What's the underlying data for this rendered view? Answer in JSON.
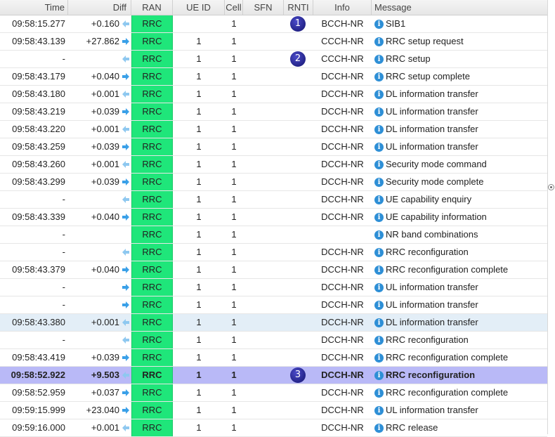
{
  "columns": {
    "time": "Time",
    "diff": "Diff",
    "ran": "RAN",
    "ue_id": "UE ID",
    "cell": "Cell",
    "sfn": "SFN",
    "rnti": "RNTI",
    "info": "Info",
    "message": "Message"
  },
  "colors": {
    "ran_cell_bg": "#1fe67a",
    "arrow_ul": "#3aa0e8",
    "arrow_dl": "#8ec8f0",
    "selected_row_bg": "#b9b9f7",
    "highlight_row_bg": "#e3eef7",
    "badge_bg": "#1e1e8a"
  },
  "rows": [
    {
      "time": "09:58:15.277",
      "diff": "+0.160",
      "dir": "dl",
      "ran": "RRC",
      "ue_id": "",
      "cell": "1",
      "sfn": "",
      "rnti": "",
      "badge": "1",
      "info": "BCCH-NR",
      "message": "SIB1"
    },
    {
      "time": "09:58:43.139",
      "diff": "+27.862",
      "dir": "ul",
      "ran": "RRC",
      "ue_id": "1",
      "cell": "1",
      "sfn": "",
      "rnti": "",
      "badge": "",
      "info": "CCCH-NR",
      "message": "RRC setup request"
    },
    {
      "time": "-",
      "diff": "",
      "dir": "dl",
      "ran": "RRC",
      "ue_id": "1",
      "cell": "1",
      "sfn": "",
      "rnti": "",
      "badge": "2",
      "info": "CCCH-NR",
      "message": "RRC setup"
    },
    {
      "time": "09:58:43.179",
      "diff": "+0.040",
      "dir": "ul",
      "ran": "RRC",
      "ue_id": "1",
      "cell": "1",
      "sfn": "",
      "rnti": "",
      "badge": "",
      "info": "DCCH-NR",
      "message": "RRC setup complete"
    },
    {
      "time": "09:58:43.180",
      "diff": "+0.001",
      "dir": "dl",
      "ran": "RRC",
      "ue_id": "1",
      "cell": "1",
      "sfn": "",
      "rnti": "",
      "badge": "",
      "info": "DCCH-NR",
      "message": "DL information transfer"
    },
    {
      "time": "09:58:43.219",
      "diff": "+0.039",
      "dir": "ul",
      "ran": "RRC",
      "ue_id": "1",
      "cell": "1",
      "sfn": "",
      "rnti": "",
      "badge": "",
      "info": "DCCH-NR",
      "message": "UL information transfer"
    },
    {
      "time": "09:58:43.220",
      "diff": "+0.001",
      "dir": "dl",
      "ran": "RRC",
      "ue_id": "1",
      "cell": "1",
      "sfn": "",
      "rnti": "",
      "badge": "",
      "info": "DCCH-NR",
      "message": "DL information transfer"
    },
    {
      "time": "09:58:43.259",
      "diff": "+0.039",
      "dir": "ul",
      "ran": "RRC",
      "ue_id": "1",
      "cell": "1",
      "sfn": "",
      "rnti": "",
      "badge": "",
      "info": "DCCH-NR",
      "message": "UL information transfer"
    },
    {
      "time": "09:58:43.260",
      "diff": "+0.001",
      "dir": "dl",
      "ran": "RRC",
      "ue_id": "1",
      "cell": "1",
      "sfn": "",
      "rnti": "",
      "badge": "",
      "info": "DCCH-NR",
      "message": "Security mode command"
    },
    {
      "time": "09:58:43.299",
      "diff": "+0.039",
      "dir": "ul",
      "ran": "RRC",
      "ue_id": "1",
      "cell": "1",
      "sfn": "",
      "rnti": "",
      "badge": "",
      "info": "DCCH-NR",
      "message": "Security mode complete"
    },
    {
      "time": "-",
      "diff": "",
      "dir": "dl",
      "ran": "RRC",
      "ue_id": "1",
      "cell": "1",
      "sfn": "",
      "rnti": "",
      "badge": "",
      "info": "DCCH-NR",
      "message": "UE capability enquiry"
    },
    {
      "time": "09:58:43.339",
      "diff": "+0.040",
      "dir": "ul",
      "ran": "RRC",
      "ue_id": "1",
      "cell": "1",
      "sfn": "",
      "rnti": "",
      "badge": "",
      "info": "DCCH-NR",
      "message": "UE capability information"
    },
    {
      "time": "-",
      "diff": "",
      "dir": "",
      "ran": "RRC",
      "ue_id": "1",
      "cell": "1",
      "sfn": "",
      "rnti": "",
      "badge": "",
      "info": "",
      "message": "NR band combinations"
    },
    {
      "time": "-",
      "diff": "",
      "dir": "dl",
      "ran": "RRC",
      "ue_id": "1",
      "cell": "1",
      "sfn": "",
      "rnti": "",
      "badge": "",
      "info": "DCCH-NR",
      "message": "RRC reconfiguration"
    },
    {
      "time": "09:58:43.379",
      "diff": "+0.040",
      "dir": "ul",
      "ran": "RRC",
      "ue_id": "1",
      "cell": "1",
      "sfn": "",
      "rnti": "",
      "badge": "",
      "info": "DCCH-NR",
      "message": "RRC reconfiguration complete"
    },
    {
      "time": "-",
      "diff": "",
      "dir": "ul",
      "ran": "RRC",
      "ue_id": "1",
      "cell": "1",
      "sfn": "",
      "rnti": "",
      "badge": "",
      "info": "DCCH-NR",
      "message": "UL information transfer"
    },
    {
      "time": "-",
      "diff": "",
      "dir": "ul",
      "ran": "RRC",
      "ue_id": "1",
      "cell": "1",
      "sfn": "",
      "rnti": "",
      "badge": "",
      "info": "DCCH-NR",
      "message": "UL information transfer"
    },
    {
      "time": "09:58:43.380",
      "diff": "+0.001",
      "dir": "dl",
      "ran": "RRC",
      "ue_id": "1",
      "cell": "1",
      "sfn": "",
      "rnti": "",
      "badge": "",
      "info": "DCCH-NR",
      "message": "DL information transfer",
      "state": "hl"
    },
    {
      "time": "-",
      "diff": "",
      "dir": "dl",
      "ran": "RRC",
      "ue_id": "1",
      "cell": "1",
      "sfn": "",
      "rnti": "",
      "badge": "",
      "info": "DCCH-NR",
      "message": "RRC reconfiguration"
    },
    {
      "time": "09:58:43.419",
      "diff": "+0.039",
      "dir": "ul",
      "ran": "RRC",
      "ue_id": "1",
      "cell": "1",
      "sfn": "",
      "rnti": "",
      "badge": "",
      "info": "DCCH-NR",
      "message": "RRC reconfiguration complete"
    },
    {
      "time": "09:58:52.922",
      "diff": "+9.503",
      "dir": "dl",
      "ran": "RRC",
      "ue_id": "1",
      "cell": "1",
      "sfn": "",
      "rnti": "",
      "badge": "3",
      "info": "DCCH-NR",
      "message": "RRC reconfiguration",
      "state": "sel"
    },
    {
      "time": "09:58:52.959",
      "diff": "+0.037",
      "dir": "ul",
      "ran": "RRC",
      "ue_id": "1",
      "cell": "1",
      "sfn": "",
      "rnti": "",
      "badge": "",
      "info": "DCCH-NR",
      "message": "RRC reconfiguration complete"
    },
    {
      "time": "09:59:15.999",
      "diff": "+23.040",
      "dir": "ul",
      "ran": "RRC",
      "ue_id": "1",
      "cell": "1",
      "sfn": "",
      "rnti": "",
      "badge": "",
      "info": "DCCH-NR",
      "message": "UL information transfer"
    },
    {
      "time": "09:59:16.000",
      "diff": "+0.001",
      "dir": "dl",
      "ran": "RRC",
      "ue_id": "1",
      "cell": "1",
      "sfn": "",
      "rnti": "",
      "badge": "",
      "info": "DCCH-NR",
      "message": "RRC release"
    }
  ]
}
